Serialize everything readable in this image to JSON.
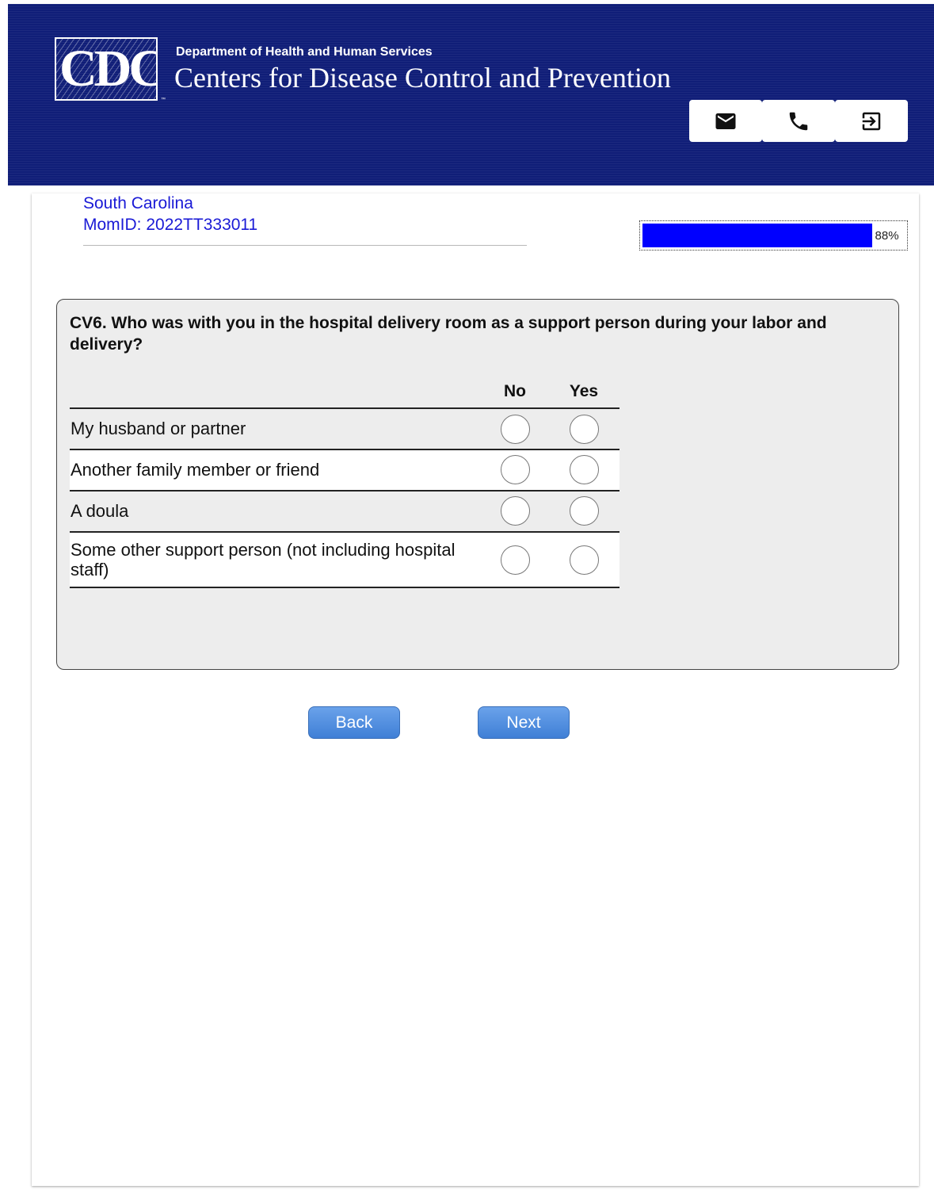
{
  "header": {
    "logo_text": "CDC",
    "logo_tm": "™",
    "department": "Department of Health and Human Services",
    "agency": "Centers for Disease Control and Prevention",
    "actions": [
      {
        "icon": "mail-icon"
      },
      {
        "icon": "phone-icon"
      },
      {
        "icon": "exit-icon"
      }
    ]
  },
  "respondent": {
    "state": "South Carolina",
    "momid": "MomID: 2022TT333011"
  },
  "progress": {
    "percent": 88,
    "label": "88%",
    "fill_color": "#0000ff"
  },
  "question": {
    "text": "CV6. Who was with you in the hospital delivery room as a support person during your labor and delivery?",
    "columns": [
      "No",
      "Yes"
    ],
    "rows": [
      {
        "label": "My husband or partner",
        "selected": null
      },
      {
        "label": "Another family member or friend",
        "selected": null
      },
      {
        "label": "A doula",
        "selected": null
      },
      {
        "label": "Some other support person (not including hospital staff)",
        "selected": null
      }
    ]
  },
  "navigation": {
    "back_label": "Back",
    "next_label": "Next"
  },
  "colors": {
    "header_bg": "#101e78",
    "link_blue": "#1a1ad6",
    "button_blue": "#4a88dd"
  }
}
